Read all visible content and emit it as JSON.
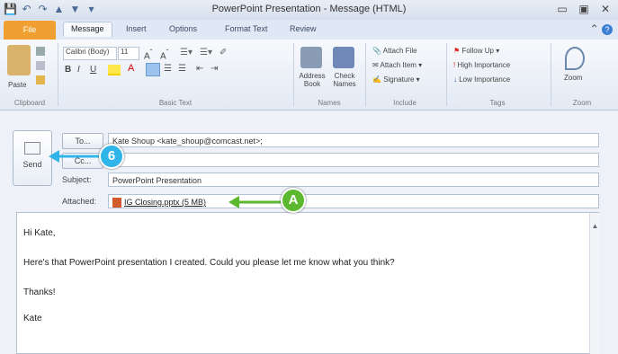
{
  "window": {
    "title": "PowerPoint Presentation - Message (HTML)",
    "controls": [
      "▭",
      "▣",
      "✕"
    ]
  },
  "quick_access": [
    "💾",
    "↶",
    "↷",
    "▲",
    "▼",
    "▾"
  ],
  "tabs": {
    "file": "File",
    "items": [
      "Message",
      "Insert",
      "Options",
      "Format Text",
      "Review"
    ]
  },
  "ribbon": {
    "clipboard": {
      "paste": "Paste",
      "label": "Clipboard"
    },
    "basic_text": {
      "font": "Calibri (Body)",
      "size": "11",
      "label": "Basic Text"
    },
    "names": {
      "address_book": "Address Book",
      "check_names": "Check Names",
      "label": "Names"
    },
    "include": {
      "attach_file": "Attach File",
      "attach_item": "Attach Item",
      "signature": "Signature",
      "label": "Include"
    },
    "tags": {
      "follow_up": "Follow Up",
      "high_importance": "High Importance",
      "low_importance": "Low Importance",
      "label": "Tags"
    },
    "zoom": {
      "zoom": "Zoom",
      "label": "Zoom"
    }
  },
  "compose": {
    "send_label": "Send",
    "to_button": "To...",
    "cc_button": "Cc...",
    "to_value": "Kate Shoup <kate_shoup@comcast.net>;",
    "cc_value": "",
    "subject_label": "Subject:",
    "subject_value": "PowerPoint Presentation",
    "attached_label": "Attached:",
    "attachment": "IG Closing.pptx (5 MB)"
  },
  "message_body": [
    "Hi Kate,",
    "Here's that PowerPoint presentation I created. Could you please let me know what you think?",
    "Thanks!",
    "Kate"
  ],
  "callouts": {
    "step": "6",
    "letter": "A"
  },
  "colors": {
    "file_tab": "#f0a030",
    "callout_blue": "#2fb5e8",
    "callout_green": "#5cb82e"
  }
}
